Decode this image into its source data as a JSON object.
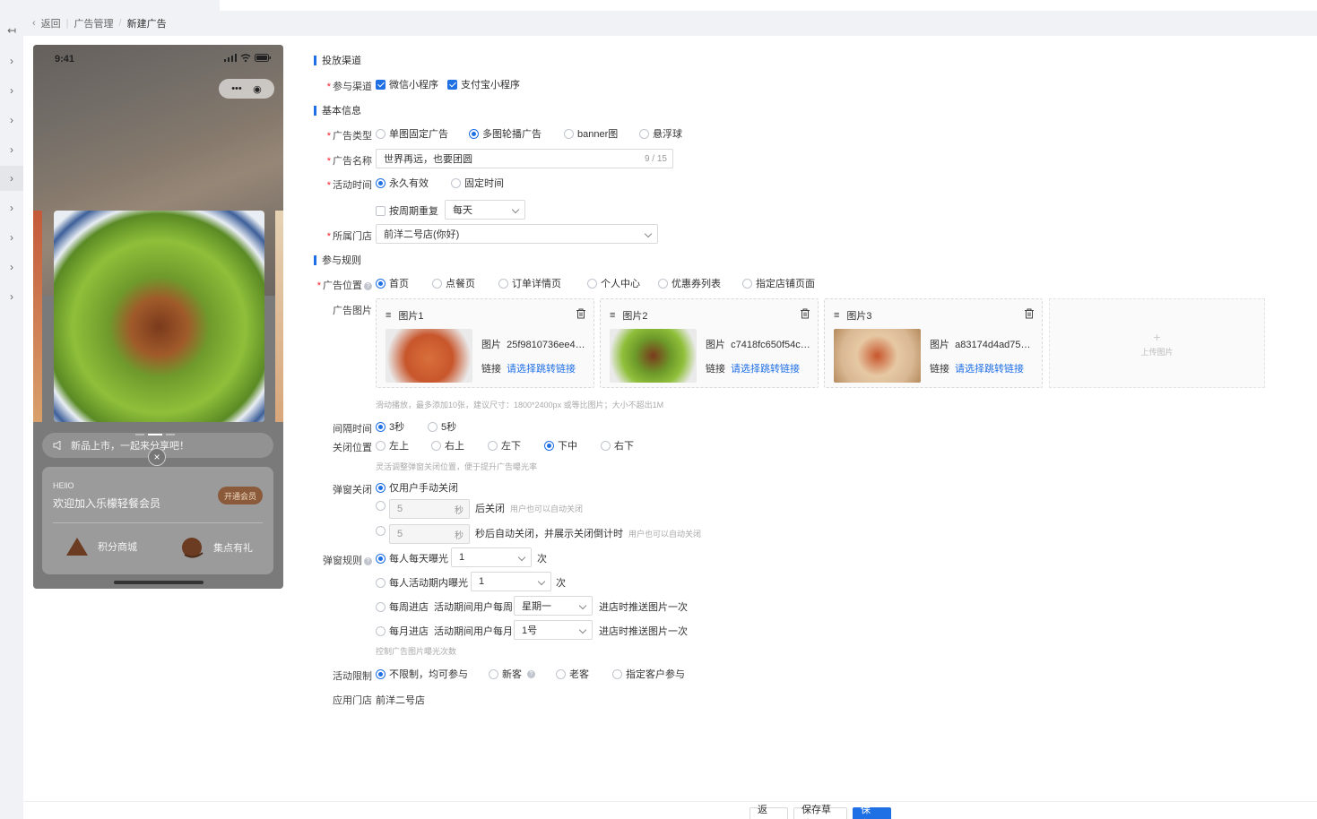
{
  "breadcrumb": {
    "back": "返回",
    "parent": "广告管理",
    "current": "新建广告"
  },
  "phone": {
    "time": "9:41",
    "notice": "新品上市，一起来分享吧！",
    "hello": "HEllO",
    "welcome": "欢迎加入乐檬轻餐会员",
    "open_member": "开通会员",
    "menu": [
      {
        "label": "积分商城"
      },
      {
        "label": "集点有礼"
      }
    ]
  },
  "sections": {
    "channel": "投放渠道",
    "basic": "基本信息",
    "rules": "参与规则"
  },
  "channel": {
    "label": "参与渠道",
    "options": [
      {
        "label": "微信小程序",
        "checked": true
      },
      {
        "label": "支付宝小程序",
        "checked": true
      }
    ]
  },
  "ad_type": {
    "label": "广告类型",
    "options": [
      {
        "label": "单图固定广告"
      },
      {
        "label": "多图轮播广告",
        "selected": true
      },
      {
        "label": "banner图"
      },
      {
        "label": "悬浮球"
      }
    ]
  },
  "ad_name": {
    "label": "广告名称",
    "value": "世界再远，也要团圆",
    "count": "9 / 15"
  },
  "activity_time": {
    "label": "活动时间",
    "options": [
      {
        "label": "永久有效",
        "selected": true
      },
      {
        "label": "固定时间"
      }
    ],
    "repeat_label": "按周期重复",
    "repeat_value": "每天"
  },
  "store": {
    "label": "所属门店",
    "value": "前洋二号店(你好)"
  },
  "position": {
    "label": "广告位置",
    "options": [
      {
        "label": "首页",
        "selected": true
      },
      {
        "label": "点餐页"
      },
      {
        "label": "订单详情页"
      },
      {
        "label": "个人中心"
      },
      {
        "label": "优惠券列表"
      },
      {
        "label": "指定店铺页面"
      }
    ]
  },
  "images": {
    "label": "广告图片",
    "pic_label": "图片",
    "link_label": "链接",
    "link_action": "请选择跳转链接",
    "items": [
      {
        "title": "图片1",
        "name": "25f9810736ee4b...",
        "thumb": "#c8562c"
      },
      {
        "title": "图片2",
        "name": "c7418fc650f54c6...",
        "thumb": "#6d9a2a"
      },
      {
        "title": "图片3",
        "name": "a83174d4ad7542...",
        "thumb": "#e6c9a4"
      }
    ],
    "upload": "上传图片",
    "hint": "滑动播放，最多添加10张，建议尺寸：1800*2400px 或等比图片；大小不超出1M"
  },
  "interval": {
    "label": "间隔时间",
    "options": [
      {
        "label": "3秒",
        "selected": true
      },
      {
        "label": "5秒"
      }
    ]
  },
  "close_pos": {
    "label": "关闭位置",
    "options": [
      {
        "label": "左上"
      },
      {
        "label": "右上"
      },
      {
        "label": "左下"
      },
      {
        "label": "下中",
        "selected": true
      },
      {
        "label": "右下"
      }
    ],
    "hint": "灵活调整弹窗关闭位置，便于提升广告曝光率"
  },
  "popup_close": {
    "label": "弹窗关闭",
    "manual": "仅用户手动关闭",
    "after": {
      "value": "5",
      "unit": "秒",
      "text": "后关闭",
      "hint": "用户也可以自动关闭"
    },
    "countdown": {
      "value": "5",
      "unit": "秒",
      "text": "秒后自动关闭，并展示关闭倒计时",
      "hint": "用户也可以自动关闭"
    }
  },
  "popup_rule": {
    "label": "弹窗规则",
    "daily": {
      "text": "每人每天曝光",
      "value": "1",
      "suffix": "次"
    },
    "period": {
      "text": "每人活动期内曝光",
      "value": "1",
      "suffix": "次"
    },
    "weekly": {
      "text": "每周进店",
      "mid": "活动期间用户每周",
      "value": "星期一",
      "suffix": "进店时推送图片一次"
    },
    "monthly": {
      "text": "每月进店",
      "mid": "活动期间用户每月",
      "value": "1号",
      "suffix": "进店时推送图片一次"
    },
    "hint": "控制广告图片曝光次数"
  },
  "limit": {
    "label": "活动限制",
    "options": [
      {
        "label": "不限制，均可参与",
        "selected": true
      },
      {
        "label": "新客"
      },
      {
        "label": "老客"
      },
      {
        "label": "指定客户参与"
      }
    ]
  },
  "apply_store": {
    "label": "应用门店",
    "value": "前洋二号店"
  },
  "footer": {
    "back": "返 回",
    "draft": "保存草稿",
    "save": "保 存"
  },
  "colors": {
    "primary": "#1f6fe5",
    "required": "#f5222d"
  }
}
